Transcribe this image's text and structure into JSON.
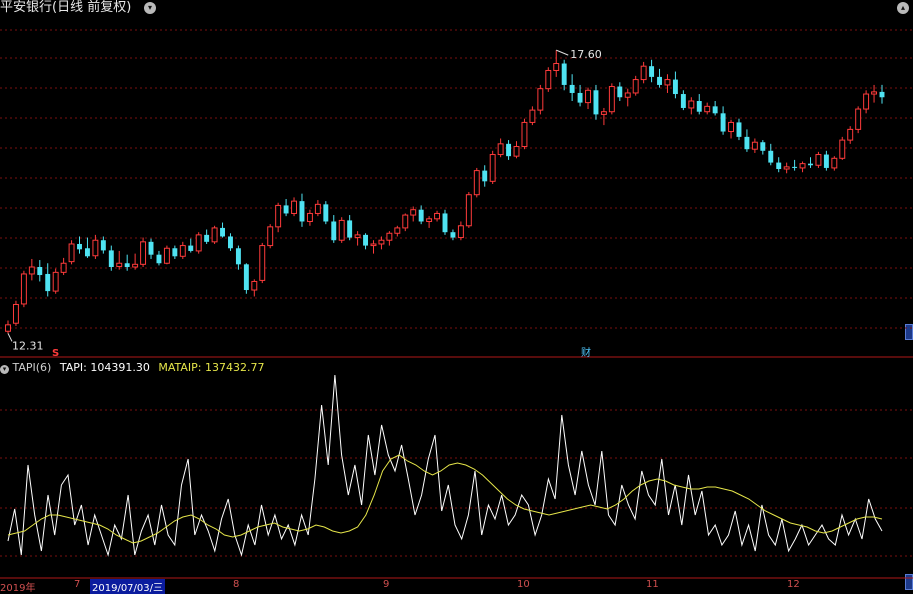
{
  "window": {
    "title": "平安银行(日线 前复权)"
  },
  "chart_data": [
    {
      "type": "candlestick",
      "title": "平安银行(日线 前复权)",
      "price_range": [
        12.0,
        18.2
      ],
      "max_label": "17.60",
      "min_label": "12.31",
      "markers": [
        {
          "label": "S",
          "color": "#ff3b3b"
        },
        {
          "label": "财",
          "color": "#4fc3f7"
        }
      ],
      "candles": [
        [
          12.35,
          12.55,
          12.31,
          12.47
        ],
        [
          12.5,
          12.92,
          12.45,
          12.85
        ],
        [
          12.86,
          13.48,
          12.8,
          13.42
        ],
        [
          13.42,
          13.7,
          13.3,
          13.55
        ],
        [
          13.55,
          13.68,
          13.28,
          13.4
        ],
        [
          13.42,
          13.62,
          13.0,
          13.1
        ],
        [
          13.1,
          13.52,
          13.05,
          13.45
        ],
        [
          13.45,
          13.72,
          13.4,
          13.62
        ],
        [
          13.65,
          14.05,
          13.6,
          13.98
        ],
        [
          13.98,
          14.12,
          13.8,
          13.88
        ],
        [
          13.9,
          14.1,
          13.72,
          13.75
        ],
        [
          13.76,
          14.15,
          13.7,
          14.05
        ],
        [
          14.05,
          14.12,
          13.8,
          13.86
        ],
        [
          13.86,
          13.95,
          13.48,
          13.55
        ],
        [
          13.56,
          13.85,
          13.5,
          13.62
        ],
        [
          13.62,
          13.78,
          13.48,
          13.55
        ],
        [
          13.55,
          13.8,
          13.5,
          13.6
        ],
        [
          13.6,
          14.1,
          13.55,
          14.02
        ],
        [
          14.02,
          14.08,
          13.7,
          13.78
        ],
        [
          13.78,
          13.85,
          13.58,
          13.62
        ],
        [
          13.62,
          13.95,
          13.6,
          13.9
        ],
        [
          13.9,
          13.95,
          13.7,
          13.75
        ],
        [
          13.75,
          14.02,
          13.7,
          13.95
        ],
        [
          13.95,
          14.08,
          13.82,
          13.85
        ],
        [
          13.85,
          14.2,
          13.8,
          14.15
        ],
        [
          14.15,
          14.25,
          13.98,
          14.02
        ],
        [
          14.02,
          14.32,
          13.98,
          14.28
        ],
        [
          14.28,
          14.38,
          14.1,
          14.12
        ],
        [
          14.12,
          14.18,
          13.85,
          13.9
        ],
        [
          13.9,
          13.95,
          13.5,
          13.6
        ],
        [
          13.6,
          13.62,
          13.05,
          13.12
        ],
        [
          13.12,
          13.32,
          13.0,
          13.28
        ],
        [
          13.3,
          14.0,
          13.25,
          13.95
        ],
        [
          13.95,
          14.35,
          13.9,
          14.3
        ],
        [
          14.3,
          14.75,
          14.2,
          14.7
        ],
        [
          14.7,
          14.82,
          14.5,
          14.55
        ],
        [
          14.55,
          14.85,
          14.5,
          14.78
        ],
        [
          14.78,
          14.92,
          14.3,
          14.4
        ],
        [
          14.4,
          14.62,
          14.32,
          14.55
        ],
        [
          14.55,
          14.8,
          14.5,
          14.72
        ],
        [
          14.72,
          14.78,
          14.35,
          14.4
        ],
        [
          14.4,
          14.52,
          14.0,
          14.05
        ],
        [
          14.05,
          14.48,
          14.0,
          14.42
        ],
        [
          14.42,
          14.52,
          14.05,
          14.1
        ],
        [
          14.1,
          14.22,
          13.95,
          14.15
        ],
        [
          14.15,
          14.18,
          13.88,
          13.95
        ],
        [
          13.95,
          14.05,
          13.8,
          13.98
        ],
        [
          13.98,
          14.12,
          13.88,
          14.05
        ],
        [
          14.05,
          14.22,
          13.95,
          14.18
        ],
        [
          14.18,
          14.32,
          14.12,
          14.28
        ],
        [
          14.28,
          14.55,
          14.22,
          14.52
        ],
        [
          14.52,
          14.68,
          14.4,
          14.62
        ],
        [
          14.62,
          14.7,
          14.35,
          14.4
        ],
        [
          14.4,
          14.5,
          14.28,
          14.45
        ],
        [
          14.45,
          14.6,
          14.4,
          14.55
        ],
        [
          14.55,
          14.62,
          14.15,
          14.2
        ],
        [
          14.2,
          14.25,
          14.05,
          14.1
        ],
        [
          14.1,
          14.4,
          14.05,
          14.32
        ],
        [
          14.32,
          14.95,
          14.28,
          14.9
        ],
        [
          14.9,
          15.4,
          14.85,
          15.35
        ],
        [
          15.35,
          15.45,
          15.05,
          15.15
        ],
        [
          15.15,
          15.72,
          15.1,
          15.65
        ],
        [
          15.65,
          15.95,
          15.6,
          15.85
        ],
        [
          15.85,
          15.92,
          15.55,
          15.62
        ],
        [
          15.62,
          15.9,
          15.58,
          15.8
        ],
        [
          15.8,
          16.32,
          15.75,
          16.25
        ],
        [
          16.25,
          16.55,
          16.2,
          16.48
        ],
        [
          16.48,
          16.95,
          16.4,
          16.88
        ],
        [
          16.88,
          17.28,
          16.82,
          17.22
        ],
        [
          17.22,
          17.6,
          17.1,
          17.35
        ],
        [
          17.35,
          17.42,
          16.85,
          16.95
        ],
        [
          16.95,
          17.15,
          16.65,
          16.8
        ],
        [
          16.8,
          16.95,
          16.55,
          16.62
        ],
        [
          16.62,
          16.9,
          16.5,
          16.85
        ],
        [
          16.85,
          16.95,
          16.3,
          16.4
        ],
        [
          16.4,
          16.52,
          16.2,
          16.45
        ],
        [
          16.45,
          16.98,
          16.4,
          16.92
        ],
        [
          16.92,
          17.0,
          16.65,
          16.72
        ],
        [
          16.72,
          16.88,
          16.55,
          16.8
        ],
        [
          16.8,
          17.12,
          16.75,
          17.05
        ],
        [
          17.05,
          17.38,
          16.98,
          17.3
        ],
        [
          17.3,
          17.42,
          17.0,
          17.1
        ],
        [
          17.1,
          17.25,
          16.9,
          16.95
        ],
        [
          16.95,
          17.15,
          16.8,
          17.05
        ],
        [
          17.05,
          17.2,
          16.7,
          16.78
        ],
        [
          16.78,
          16.85,
          16.48,
          16.52
        ],
        [
          16.52,
          16.72,
          16.4,
          16.65
        ],
        [
          16.65,
          16.78,
          16.4,
          16.45
        ],
        [
          16.45,
          16.62,
          16.4,
          16.55
        ],
        [
          16.55,
          16.65,
          16.38,
          16.42
        ],
        [
          16.42,
          16.55,
          16.02,
          16.08
        ],
        [
          16.08,
          16.3,
          15.95,
          16.25
        ],
        [
          16.25,
          16.32,
          15.92,
          15.98
        ],
        [
          15.98,
          16.12,
          15.7,
          15.75
        ],
        [
          15.75,
          15.95,
          15.68,
          15.88
        ],
        [
          15.88,
          15.92,
          15.65,
          15.72
        ],
        [
          15.72,
          15.85,
          15.45,
          15.5
        ],
        [
          15.5,
          15.6,
          15.32,
          15.38
        ],
        [
          15.38,
          15.5,
          15.3,
          15.42
        ],
        [
          15.42,
          15.55,
          15.35,
          15.4
        ],
        [
          15.4,
          15.52,
          15.32,
          15.48
        ],
        [
          15.48,
          15.6,
          15.4,
          15.45
        ],
        [
          15.45,
          15.7,
          15.4,
          15.65
        ],
        [
          15.65,
          15.72,
          15.35,
          15.4
        ],
        [
          15.4,
          15.62,
          15.35,
          15.58
        ],
        [
          15.58,
          15.98,
          15.55,
          15.92
        ],
        [
          15.92,
          16.18,
          15.85,
          16.12
        ],
        [
          16.12,
          16.55,
          16.05,
          16.5
        ],
        [
          16.5,
          16.85,
          16.42,
          16.78
        ],
        [
          16.78,
          16.95,
          16.62,
          16.82
        ],
        [
          16.82,
          16.95,
          16.6,
          16.72
        ]
      ]
    },
    {
      "type": "line",
      "indicator": "TAPI(6)",
      "series": [
        {
          "name": "TAPI",
          "color": "#ffffff",
          "last_value_label": "104391.30",
          "values": [
            0.17,
            0.33,
            0.1,
            0.55,
            0.3,
            0.12,
            0.4,
            0.2,
            0.45,
            0.5,
            0.25,
            0.35,
            0.15,
            0.3,
            0.2,
            0.1,
            0.25,
            0.18,
            0.4,
            0.1,
            0.22,
            0.3,
            0.15,
            0.35,
            0.2,
            0.15,
            0.45,
            0.58,
            0.2,
            0.3,
            0.22,
            0.12,
            0.28,
            0.38,
            0.2,
            0.1,
            0.25,
            0.15,
            0.35,
            0.2,
            0.3,
            0.18,
            0.25,
            0.15,
            0.3,
            0.2,
            0.48,
            0.85,
            0.55,
            1.0,
            0.6,
            0.4,
            0.55,
            0.35,
            0.7,
            0.5,
            0.75,
            0.6,
            0.52,
            0.65,
            0.48,
            0.3,
            0.4,
            0.58,
            0.7,
            0.32,
            0.45,
            0.25,
            0.18,
            0.3,
            0.52,
            0.2,
            0.35,
            0.28,
            0.4,
            0.25,
            0.3,
            0.4,
            0.35,
            0.2,
            0.3,
            0.48,
            0.38,
            0.8,
            0.55,
            0.4,
            0.62,
            0.45,
            0.35,
            0.62,
            0.3,
            0.25,
            0.45,
            0.35,
            0.28,
            0.52,
            0.4,
            0.35,
            0.58,
            0.3,
            0.45,
            0.25,
            0.5,
            0.3,
            0.42,
            0.2,
            0.25,
            0.15,
            0.2,
            0.32,
            0.15,
            0.25,
            0.12,
            0.35,
            0.2,
            0.15,
            0.28,
            0.12,
            0.18,
            0.25,
            0.15,
            0.2,
            0.25,
            0.18,
            0.15,
            0.3,
            0.2,
            0.28,
            0.18,
            0.38,
            0.28,
            0.22
          ]
        },
        {
          "name": "MATAIP",
          "color": "#e6e64a",
          "last_value_label": "137432.77",
          "values": [
            0.2,
            0.21,
            0.22,
            0.25,
            0.28,
            0.3,
            0.3,
            0.29,
            0.28,
            0.27,
            0.26,
            0.25,
            0.23,
            0.2,
            0.18,
            0.16,
            0.17,
            0.19,
            0.21,
            0.24,
            0.27,
            0.29,
            0.3,
            0.28,
            0.25,
            0.23,
            0.2,
            0.19,
            0.2,
            0.22,
            0.24,
            0.25,
            0.26,
            0.24,
            0.23,
            0.22,
            0.23,
            0.25,
            0.24,
            0.22,
            0.21,
            0.22,
            0.24,
            0.3,
            0.4,
            0.52,
            0.58,
            0.6,
            0.57,
            0.55,
            0.52,
            0.5,
            0.52,
            0.55,
            0.56,
            0.55,
            0.53,
            0.5,
            0.46,
            0.42,
            0.38,
            0.35,
            0.33,
            0.32,
            0.31,
            0.3,
            0.31,
            0.32,
            0.33,
            0.34,
            0.35,
            0.34,
            0.33,
            0.35,
            0.38,
            0.42,
            0.45,
            0.47,
            0.48,
            0.47,
            0.45,
            0.44,
            0.43,
            0.43,
            0.44,
            0.44,
            0.43,
            0.42,
            0.4,
            0.38,
            0.35,
            0.32,
            0.3,
            0.28,
            0.26,
            0.25,
            0.24,
            0.22,
            0.21,
            0.22,
            0.24,
            0.26,
            0.28,
            0.29,
            0.29,
            0.28
          ]
        }
      ]
    }
  ],
  "x_labels": [
    "2019年",
    "7",
    "2019/07/03/三",
    "8",
    "9",
    "10",
    "11",
    "12"
  ]
}
